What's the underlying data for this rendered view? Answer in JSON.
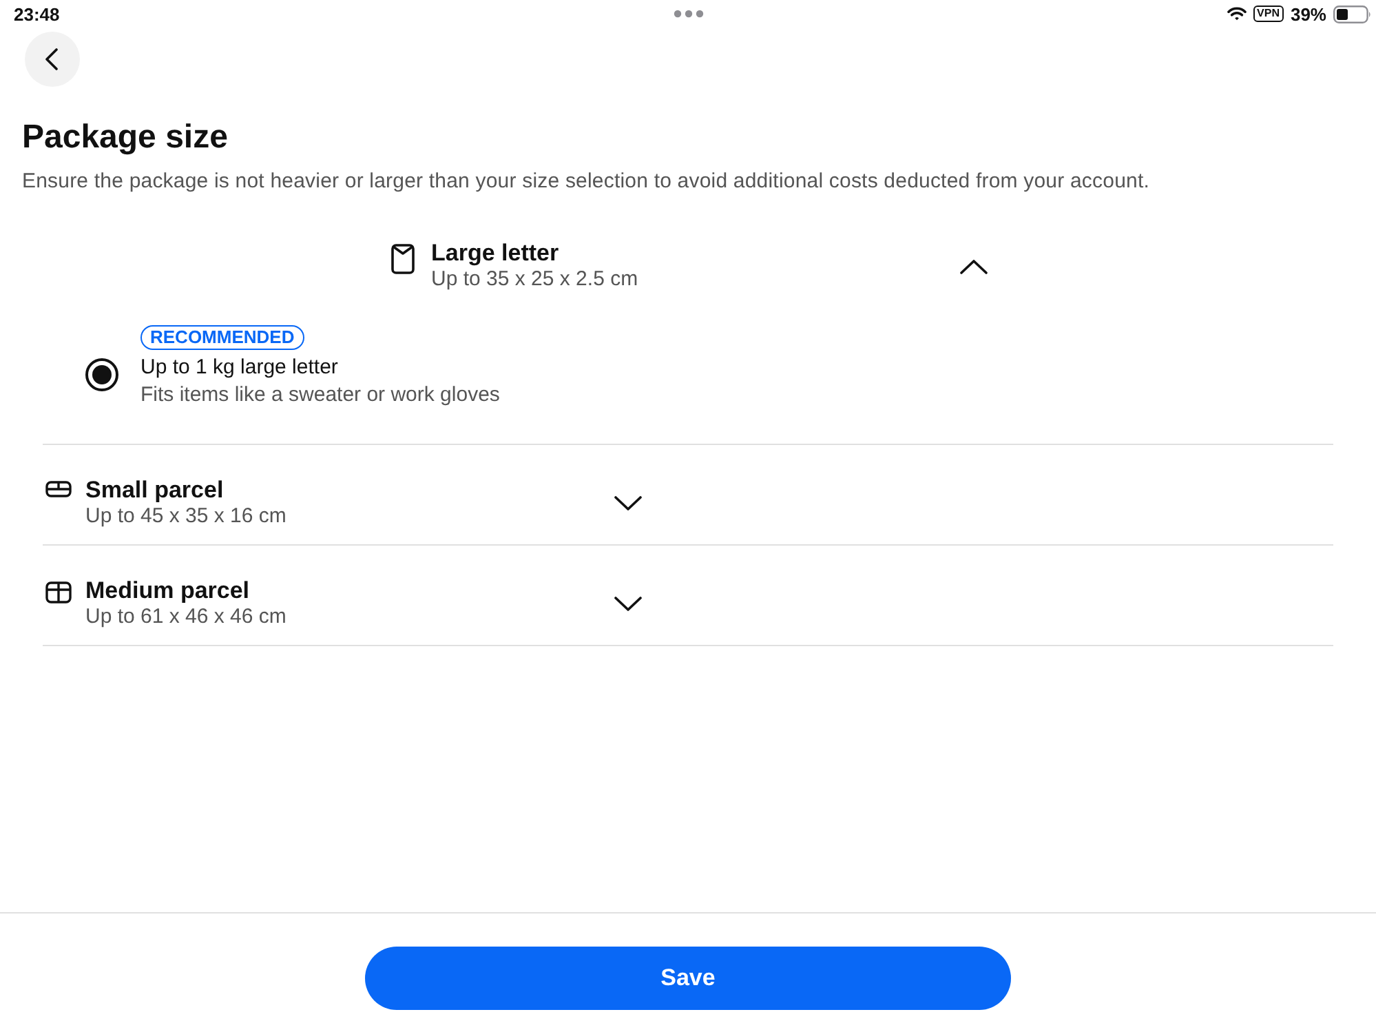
{
  "status_bar": {
    "time": "23:48",
    "vpn": "VPN",
    "battery": "39%"
  },
  "page": {
    "title": "Package size",
    "description": "Ensure the package is not heavier or larger than your size selection to avoid additional costs deducted from your account."
  },
  "sections": [
    {
      "kind": "letter",
      "name": "Large letter",
      "dimensions": "Up to 35 x 25 x 2.5 cm",
      "expanded": true,
      "options": [
        {
          "badge": "RECOMMENDED",
          "title": "Up to 1 kg large letter",
          "description": "Fits items like a sweater or work gloves",
          "selected": true
        }
      ]
    },
    {
      "kind": "small_parcel",
      "name": "Small parcel",
      "dimensions": "Up to 45 x 35 x 16 cm",
      "expanded": false
    },
    {
      "kind": "medium_parcel",
      "name": "Medium parcel",
      "dimensions": "Up to 61 x 46 x 46 cm",
      "expanded": false
    }
  ],
  "save_button": {
    "label": "Save"
  }
}
